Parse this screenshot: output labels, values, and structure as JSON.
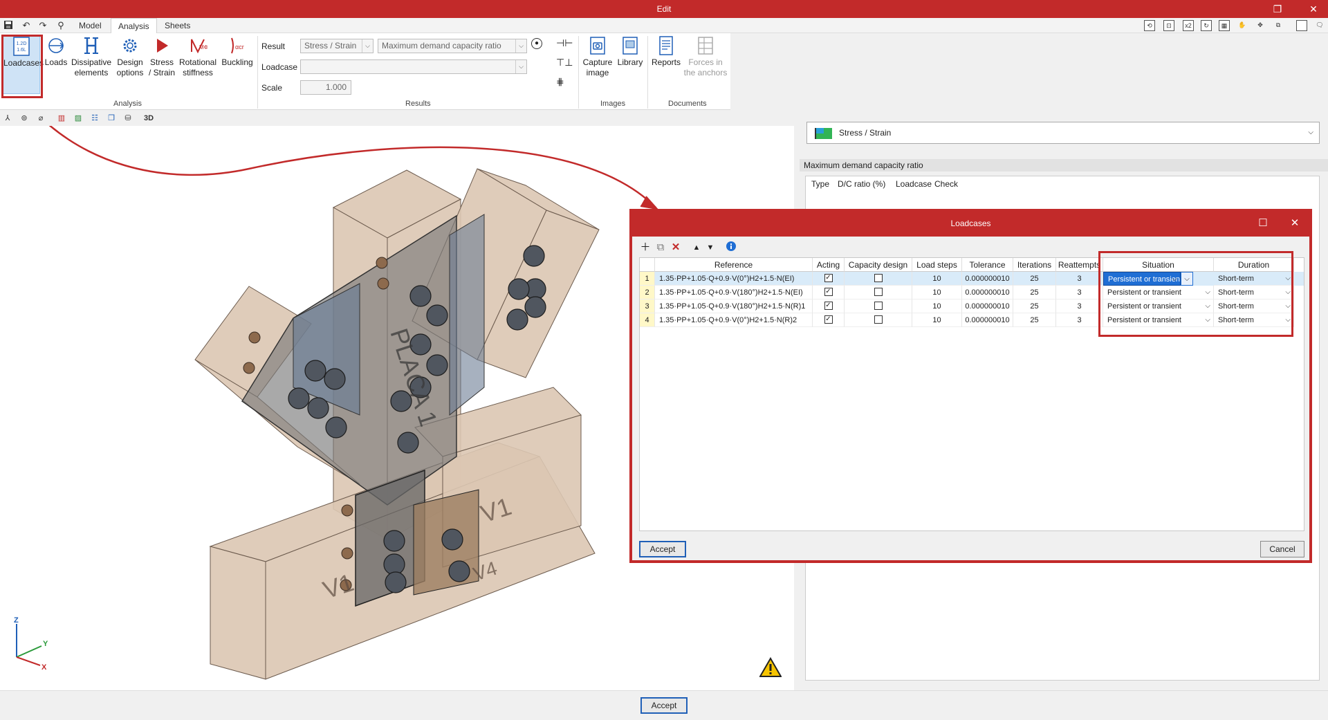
{
  "window": {
    "title": "Edit",
    "restore": "❐",
    "close": "✕"
  },
  "menu": {
    "tabs": [
      "Model",
      "Analysis",
      "Sheets"
    ],
    "active": "Analysis"
  },
  "ribbon": {
    "analysis_buttons": [
      {
        "label": "Loadcases",
        "icon": "loadcases-icon"
      },
      {
        "label": "Loads",
        "icon": "loads-icon"
      },
      {
        "label": "Dissipative elements",
        "icon": "dissipative-icon"
      },
      {
        "label": "Design options",
        "icon": "gear-icon"
      },
      {
        "label": "Stress / Strain",
        "icon": "play-icon"
      },
      {
        "label": "Rotational stiffness",
        "icon": "rotational-stiffness-icon"
      },
      {
        "label": "Buckling",
        "icon": "buckling-icon"
      }
    ],
    "analysis_group": "Analysis",
    "result_label": "Result",
    "result_value": "Stress / Strain",
    "result_type": "Maximum demand capacity ratio",
    "loadcase_label": "Loadcase",
    "loadcase_value": "",
    "scale_label": "Scale",
    "scale_value": "1.000",
    "results_group": "Results",
    "capture_label": "Capture image",
    "library_label": "Library",
    "images_group": "Images",
    "reports_label": "Reports",
    "forces_label": "Forces in the anchors",
    "documents_group": "Documents"
  },
  "right_panel": {
    "combo_value": "Stress / Strain",
    "header": "Maximum demand capacity ratio",
    "columns": [
      "Type",
      "D/C ratio (%)",
      "Loadcase",
      "Check"
    ]
  },
  "dialog": {
    "title": "Loadcases",
    "columns": [
      "Reference",
      "Acting",
      "Capacity design",
      "Load steps",
      "Tolerance",
      "Iterations",
      "Reattempts",
      "Situation",
      "Duration"
    ],
    "rows": [
      {
        "n": "1",
        "reference": "1.35·PP+1.05·Q+0.9·V(0°)H2+1.5·N(EI)",
        "acting": true,
        "capacity": false,
        "steps": "10",
        "tolerance": "0.000000010",
        "iterations": "25",
        "reattempts": "3",
        "situation": "Persistent or transient",
        "duration": "Short-term"
      },
      {
        "n": "2",
        "reference": "1.35·PP+1.05·Q+0.9·V(180°)H2+1.5·N(EI)",
        "acting": true,
        "capacity": false,
        "steps": "10",
        "tolerance": "0.000000010",
        "iterations": "25",
        "reattempts": "3",
        "situation": "Persistent or transient",
        "duration": "Short-term"
      },
      {
        "n": "3",
        "reference": "1.35·PP+1.05·Q+0.9·V(180°)H2+1.5·N(R)1",
        "acting": true,
        "capacity": false,
        "steps": "10",
        "tolerance": "0.000000010",
        "iterations": "25",
        "reattempts": "3",
        "situation": "Persistent or transient",
        "duration": "Short-term"
      },
      {
        "n": "4",
        "reference": "1.35·PP+1.05·Q+0.9·V(0°)H2+1.5·N(R)2",
        "acting": true,
        "capacity": false,
        "steps": "10",
        "tolerance": "0.000000010",
        "iterations": "25",
        "reattempts": "3",
        "situation": "Persistent or transient",
        "duration": "Short-term"
      }
    ],
    "accept": "Accept",
    "cancel": "Cancel"
  },
  "viewport": {
    "labels": {
      "plate": "PLACA 1",
      "v1a": "V1",
      "v1b": "V1",
      "v4": "V4"
    },
    "axes": {
      "z": "Z",
      "y": "Y",
      "x": "X"
    }
  },
  "bottom": {
    "accept": "Accept"
  },
  "colors": {
    "accent_red": "#c22a2a",
    "select_blue": "#1f6ed4",
    "wood": "#d9c2b0"
  }
}
